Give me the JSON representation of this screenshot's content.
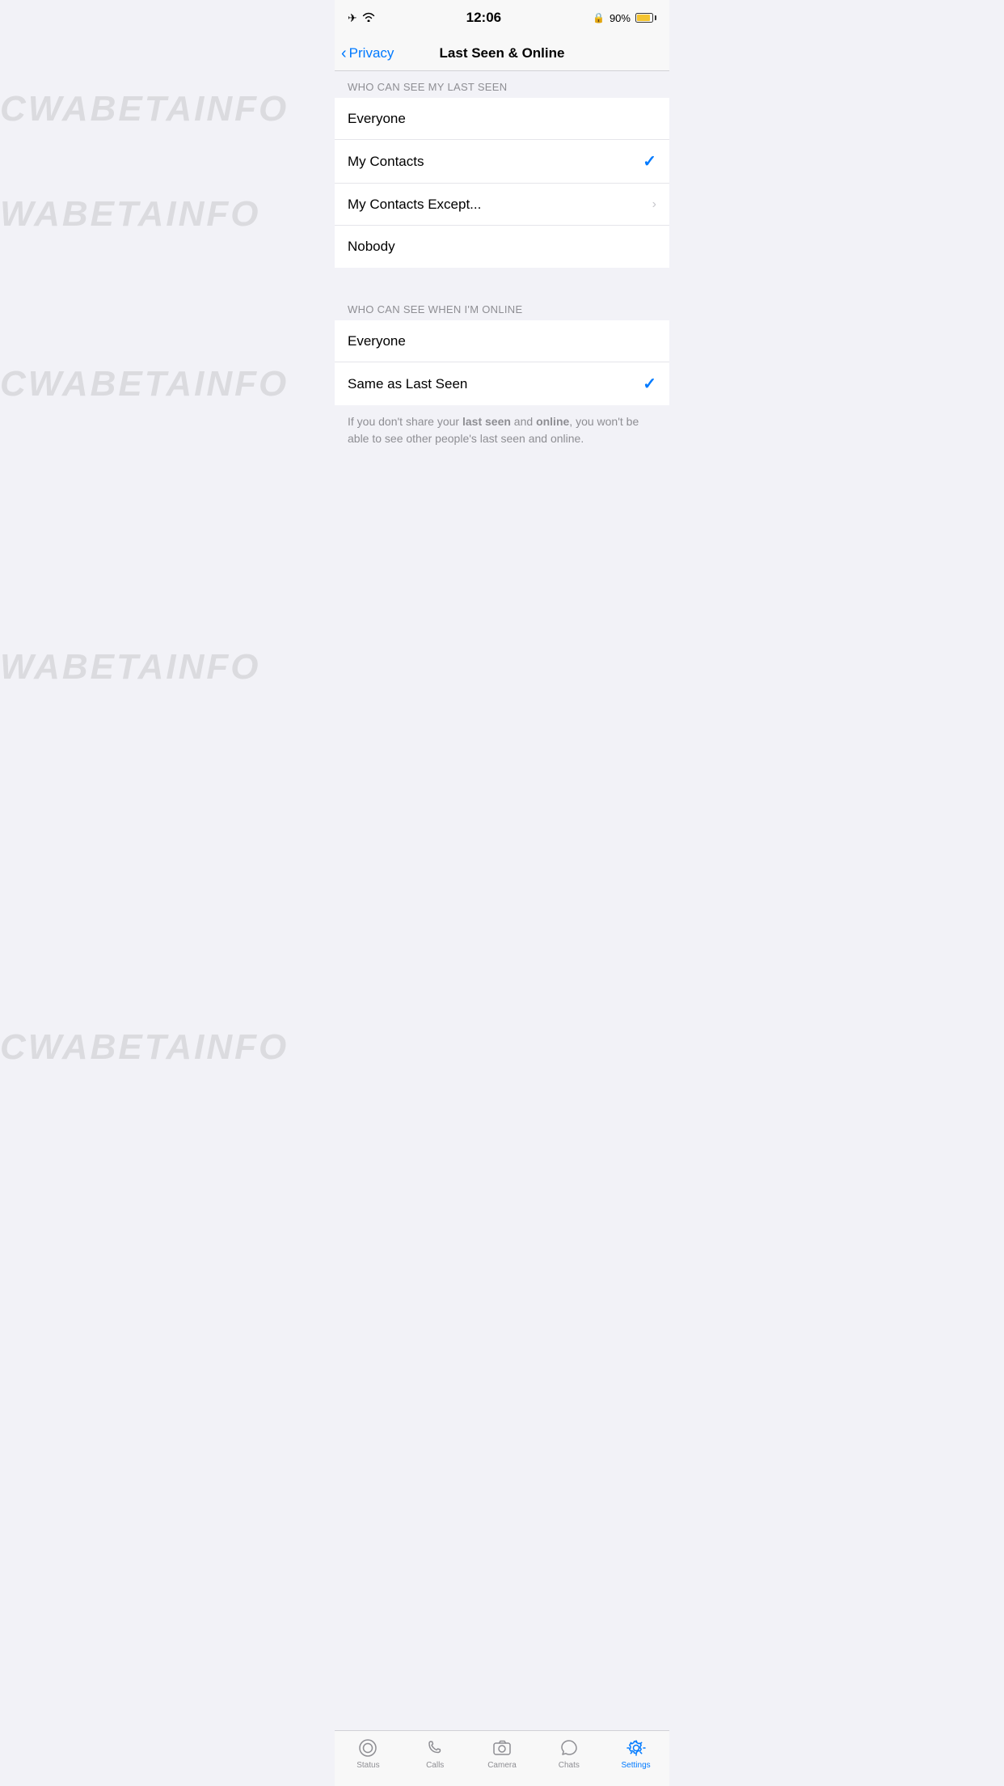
{
  "statusBar": {
    "time": "12:06",
    "battery": "90%",
    "icons": [
      "airplane",
      "wifi",
      "lock"
    ]
  },
  "header": {
    "title": "Last Seen & Online",
    "backLabel": "Privacy"
  },
  "sections": [
    {
      "id": "last-seen",
      "header": "WHO CAN SEE MY LAST SEEN",
      "items": [
        {
          "id": "everyone-last",
          "label": "Everyone",
          "checked": false,
          "hasChevron": false
        },
        {
          "id": "my-contacts-last",
          "label": "My Contacts",
          "checked": true,
          "hasChevron": false
        },
        {
          "id": "my-contacts-except-last",
          "label": "My Contacts Except...",
          "checked": false,
          "hasChevron": true
        },
        {
          "id": "nobody-last",
          "label": "Nobody",
          "checked": false,
          "hasChevron": false
        }
      ]
    },
    {
      "id": "online",
      "header": "WHO CAN SEE WHEN I'M ONLINE",
      "items": [
        {
          "id": "everyone-online",
          "label": "Everyone",
          "checked": false,
          "hasChevron": false
        },
        {
          "id": "same-as-last-seen",
          "label": "Same as Last Seen",
          "checked": true,
          "hasChevron": false
        }
      ]
    }
  ],
  "infoText": {
    "prefix": "If you don't share your ",
    "bold1": "last seen",
    "middle": " and ",
    "bold2": "online",
    "suffix": ", you won't be able to see other people's last seen and online."
  },
  "watermark": "WABETAINFO",
  "tabBar": {
    "items": [
      {
        "id": "status",
        "label": "Status",
        "active": false
      },
      {
        "id": "calls",
        "label": "Calls",
        "active": false
      },
      {
        "id": "camera",
        "label": "Camera",
        "active": false
      },
      {
        "id": "chats",
        "label": "Chats",
        "active": false
      },
      {
        "id": "settings",
        "label": "Settings",
        "active": true
      }
    ]
  }
}
